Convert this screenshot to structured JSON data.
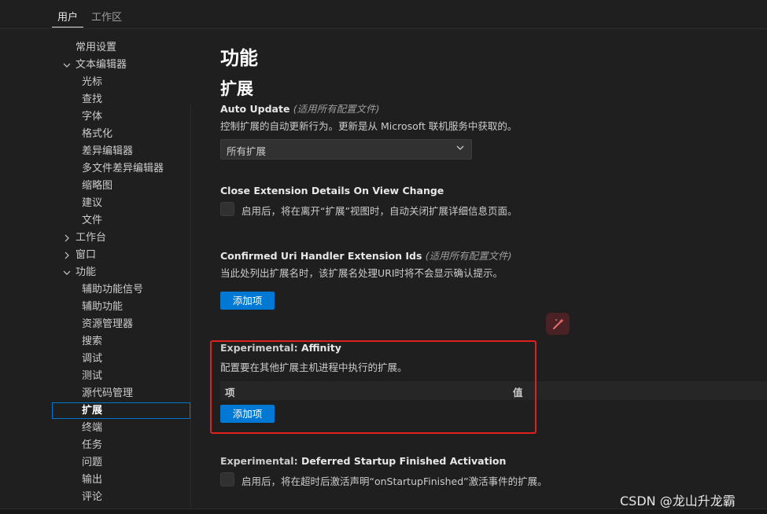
{
  "tabs": {
    "user": "用户",
    "workspace": "工作区"
  },
  "toc": {
    "items": [
      {
        "label": "常用设置",
        "indent": 0
      },
      {
        "label": "文本编辑器",
        "indent": 0,
        "expand": "open"
      },
      {
        "label": "光标",
        "indent": 1
      },
      {
        "label": "查找",
        "indent": 1
      },
      {
        "label": "字体",
        "indent": 1
      },
      {
        "label": "格式化",
        "indent": 1
      },
      {
        "label": "差异编辑器",
        "indent": 1
      },
      {
        "label": "多文件差异编辑器",
        "indent": 1
      },
      {
        "label": "缩略图",
        "indent": 1
      },
      {
        "label": "建议",
        "indent": 1
      },
      {
        "label": "文件",
        "indent": 1
      },
      {
        "label": "工作台",
        "indent": 0,
        "expand": "closed"
      },
      {
        "label": "窗口",
        "indent": 0,
        "expand": "closed"
      },
      {
        "label": "功能",
        "indent": 0,
        "expand": "open"
      },
      {
        "label": "辅助功能信号",
        "indent": 1
      },
      {
        "label": "辅助功能",
        "indent": 1
      },
      {
        "label": "资源管理器",
        "indent": 1
      },
      {
        "label": "搜索",
        "indent": 1
      },
      {
        "label": "调试",
        "indent": 1
      },
      {
        "label": "测试",
        "indent": 1
      },
      {
        "label": "源代码管理",
        "indent": 1
      },
      {
        "label": "扩展",
        "indent": 1,
        "selected": true
      },
      {
        "label": "终端",
        "indent": 1
      },
      {
        "label": "任务",
        "indent": 1
      },
      {
        "label": "问题",
        "indent": 1
      },
      {
        "label": "输出",
        "indent": 1
      },
      {
        "label": "评论",
        "indent": 1
      }
    ]
  },
  "content": {
    "h1": "功能",
    "h2": "扩展",
    "auto_update": {
      "title": "Auto Update",
      "scope": "(适用所有配置文件)",
      "desc": "控制扩展的自动更新行为。更新是从 Microsoft 联机服务中获取的。",
      "value": "所有扩展"
    },
    "close_details": {
      "title": "Close Extension Details On View Change",
      "checkbox_label": "启用后，将在离开“扩展”视图时，自动关闭扩展详细信息页面。"
    },
    "confirmed_uri": {
      "title": "Confirmed Uri Handler Extension Ids",
      "scope": "(适用所有配置文件)",
      "desc": "当此处列出扩展名时，该扩展名处理URI时将不会显示确认提示。",
      "button": "添加项"
    },
    "affinity": {
      "category": "Experimental:",
      "title": "Affinity",
      "desc": "配置要在其他扩展主机进程中执行的扩展。",
      "col_key": "项",
      "col_value": "值",
      "button": "添加项"
    },
    "deferred": {
      "category": "Experimental:",
      "title": "Deferred Startup Finished Activation",
      "checkbox_label": "启用后，将在超时后激活声明“onStartupFinished”激活事件的扩展。"
    }
  },
  "watermark": "CSDN @龙山升龙霸",
  "colors": {
    "accent": "#0078d4",
    "highlight": "#e0201c",
    "background": "#1f1f1f"
  }
}
